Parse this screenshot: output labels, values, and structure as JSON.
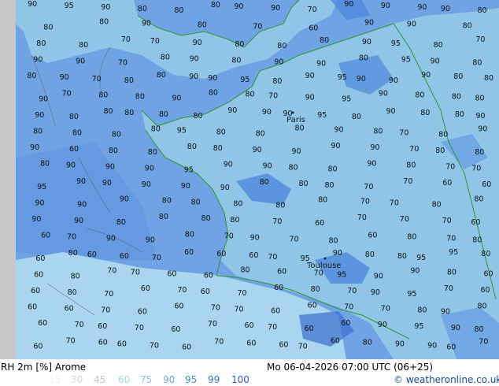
{
  "footer": {
    "title": "RH 2m [%] Arome",
    "datetime": "Mo 06-04-2026 07:00 UTC (06+25)",
    "credit": "© weatheronline.co.uk"
  },
  "legend": [
    {
      "value": "15",
      "color": "#f0f0f0"
    },
    {
      "value": "30",
      "color": "#d9d9d9"
    },
    {
      "value": "45",
      "color": "#c4c4c4"
    },
    {
      "value": "60",
      "color": "#a9d6ee"
    },
    {
      "value": "75",
      "color": "#8fc6e8"
    },
    {
      "value": "90",
      "color": "#6ea4e6"
    },
    {
      "value": "95",
      "color": "#4f88dc"
    },
    {
      "value": "99",
      "color": "#3a6fd0"
    },
    {
      "value": "100",
      "color": "#2f5fc4"
    }
  ],
  "cities": [
    {
      "name": "Paris"
    },
    {
      "name": "Toulouse"
    }
  ],
  "map_labels": {
    "row1": [
      "90",
      "95",
      "90",
      "80",
      "80",
      "80",
      "90",
      "90",
      "70",
      "90",
      "90",
      "90",
      "90",
      "80"
    ],
    "row2": [
      "80",
      "80",
      "90",
      "80",
      "70",
      "60",
      "90",
      "90",
      "80"
    ],
    "row3": [
      "80",
      "80",
      "70",
      "70",
      "90",
      "80",
      "80",
      "80",
      "90",
      "95",
      "80",
      "70"
    ],
    "row4": [
      "90",
      "90",
      "70",
      "80",
      "90",
      "80",
      "90",
      "90",
      "80",
      "95",
      "90",
      "80"
    ],
    "row5": [
      "80",
      "90",
      "70",
      "80",
      "80",
      "90",
      "90",
      "95",
      "80",
      "90",
      "95",
      "90",
      "90",
      "90",
      "80",
      "80"
    ],
    "row6": [
      "90",
      "70",
      "80",
      "80",
      "90",
      "80",
      "80",
      "70",
      "90",
      "95",
      "90",
      "80",
      "80",
      "80"
    ],
    "row7": [
      "90",
      "80",
      "80",
      "80",
      "80",
      "80",
      "90",
      "90",
      "90",
      "95",
      "80",
      "90",
      "80",
      "80",
      "90"
    ],
    "row8": [
      "80",
      "80",
      "80",
      "80",
      "95",
      "80",
      "80",
      "80",
      "90",
      "80",
      "70",
      "80",
      "90"
    ],
    "row9": [
      "90",
      "60",
      "80",
      "80",
      "80",
      "80",
      "90",
      "90",
      "90",
      "90",
      "70",
      "80",
      "80"
    ],
    "row10": [
      "80",
      "90",
      "90",
      "90",
      "95",
      "90",
      "90",
      "80",
      "80",
      "90",
      "80",
      "70",
      "70"
    ],
    "row11": [
      "95",
      "90",
      "90",
      "90",
      "90",
      "90",
      "80",
      "80",
      "80",
      "70",
      "70",
      "60",
      "60"
    ],
    "row12": [
      "90",
      "90",
      "90",
      "80",
      "80",
      "80",
      "80",
      "80",
      "70",
      "70",
      "80",
      "80"
    ],
    "row13": [
      "90",
      "90",
      "80",
      "80",
      "80",
      "80",
      "70",
      "60",
      "70",
      "70",
      "70",
      "60"
    ],
    "row14": [
      "60",
      "70",
      "90",
      "90",
      "80",
      "70",
      "90",
      "70",
      "80",
      "60",
      "80",
      "70",
      "80"
    ],
    "row15": [
      "60",
      "80",
      "60",
      "60",
      "70",
      "60",
      "60",
      "60",
      "70",
      "95",
      "90",
      "80",
      "80",
      "95",
      "95",
      "80"
    ],
    "row16": [
      "60",
      "80",
      "70",
      "70",
      "60",
      "60",
      "80",
      "60",
      "70",
      "95",
      "90",
      "90",
      "80",
      "60"
    ],
    "row17": [
      "60",
      "80",
      "70",
      "60",
      "70",
      "60",
      "70",
      "60",
      "80",
      "70",
      "90",
      "95",
      "70",
      "60"
    ],
    "row18": [
      "60",
      "60",
      "70",
      "60",
      "60",
      "70",
      "70",
      "60",
      "60",
      "70",
      "70",
      "80",
      "90",
      "80"
    ],
    "row19": [
      "60",
      "70",
      "60",
      "70",
      "60",
      "70",
      "60",
      "70",
      "60",
      "60",
      "90",
      "95",
      "90",
      "80"
    ],
    "row20": [
      "60",
      "70",
      "60",
      "60",
      "70",
      "60",
      "70",
      "60",
      "60",
      "70",
      "60",
      "80",
      "90",
      "90",
      "60",
      "70"
    ]
  }
}
